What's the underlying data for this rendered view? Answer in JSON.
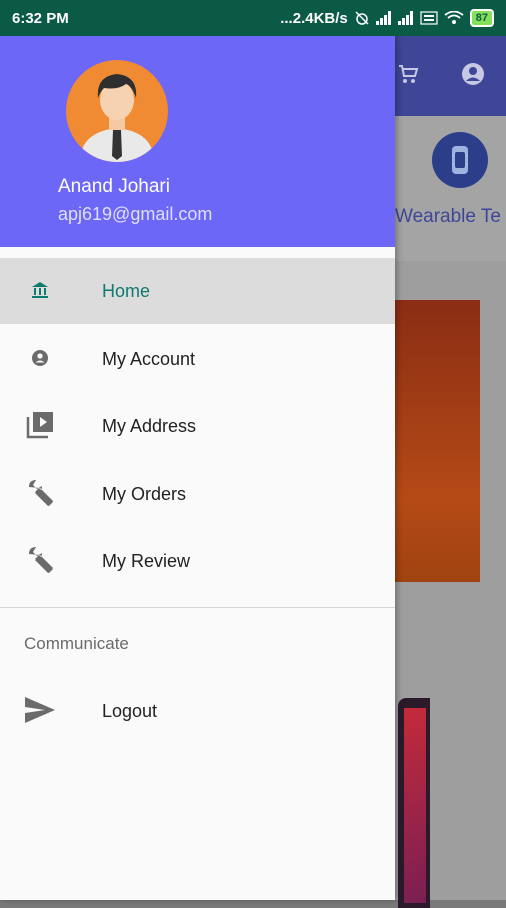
{
  "status_bar": {
    "time": "6:32 PM",
    "net_speed": "...2.4KB/s",
    "battery_level": "87"
  },
  "background": {
    "category_label": "Wearable Te",
    "toolbar_icons": [
      "cart-icon",
      "account-icon"
    ]
  },
  "drawer": {
    "user": {
      "name": "Anand Johari",
      "email": "apj619@gmail.com"
    },
    "menu": [
      {
        "label": "Home",
        "icon": "bank-icon",
        "active": true
      },
      {
        "label": "My Account",
        "icon": "account-circle-icon",
        "active": false
      },
      {
        "label": "My Address",
        "icon": "video-library-icon",
        "active": false
      },
      {
        "label": "My Orders",
        "icon": "wrench-icon",
        "active": false
      },
      {
        "label": "My Review",
        "icon": "wrench-icon",
        "active": false
      }
    ],
    "section_label": "Communicate",
    "section_items": [
      {
        "label": "Logout",
        "icon": "send-icon"
      }
    ]
  },
  "colors": {
    "header": "#6c67f6",
    "status_bar": "#0b5a45",
    "active_text": "#0f7a6e"
  }
}
